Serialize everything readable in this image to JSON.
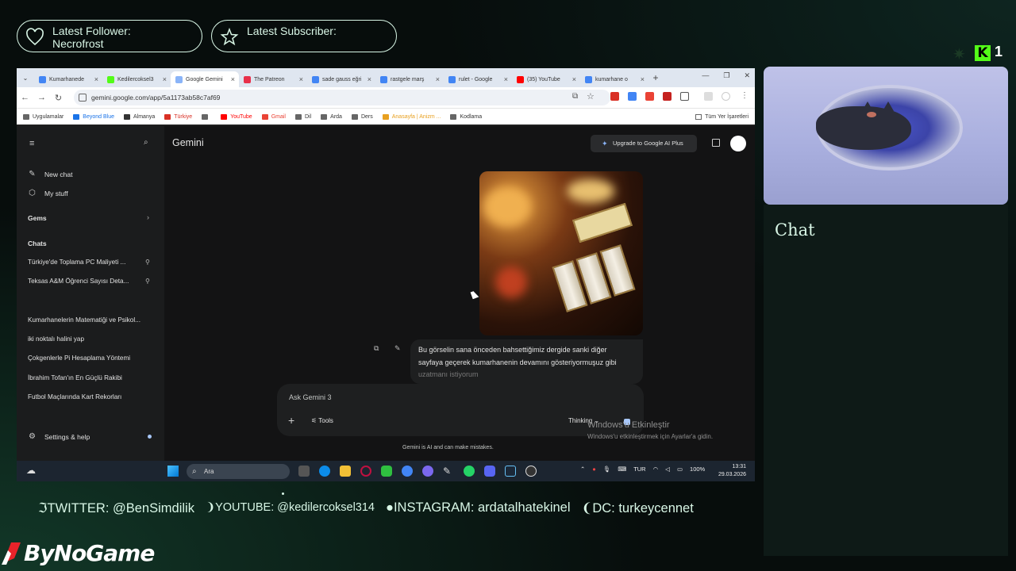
{
  "overlay": {
    "latest_follower_label": "Latest Follower:",
    "latest_follower_name": "Necrofrost",
    "latest_subscriber_label": "Latest Subscriber:",
    "kick_logo": "K",
    "kick_viewers": "1",
    "chat_title": "Chat",
    "socials": {
      "twitter": "TWITTER: @BenSimdilik",
      "youtube": "YOUTUBE: @kedilercoksel314",
      "instagram": "INSTAGRAM: ardatalhatekinel",
      "discord": "DC: turkeycennet"
    },
    "brand": "ByNoGame",
    "accent_color": "#d8f6e6",
    "kick_color": "#53fc18"
  },
  "browser": {
    "tabs": [
      {
        "label": "Kumarhanede",
        "fav_color": "#4285f4"
      },
      {
        "label": "Kedilercoksel3",
        "fav_color": "#53fc18"
      },
      {
        "label": "Google Gemini",
        "fav_color": "#8ab4f8",
        "active": true
      },
      {
        "label": "The Patreon",
        "fav_color": "#e8304a"
      },
      {
        "label": "sade gauss eğri",
        "fav_color": "#4285f4"
      },
      {
        "label": "rastgele marş",
        "fav_color": "#4285f4"
      },
      {
        "label": "rulet - Google",
        "fav_color": "#4285f4"
      },
      {
        "label": "(35) YouTube",
        "fav_color": "#ff0000"
      },
      {
        "label": "kumarhane o",
        "fav_color": "#4285f4"
      }
    ],
    "url": "gemini.google.com/app/5a1173ab58c7af69",
    "bookmarks": [
      {
        "label": "Uygulamalar",
        "color": "#666"
      },
      {
        "label": "Beyond Blue",
        "color": "#1a73e8"
      },
      {
        "label": "Almanya",
        "color": "#333"
      },
      {
        "label": "Türkiye",
        "color": "#d93025"
      },
      {
        "label": "",
        "color": "#666"
      },
      {
        "label": "YouTube",
        "color": "#ff0000"
      },
      {
        "label": "Gmail",
        "color": "#ea4335"
      },
      {
        "label": "Dil",
        "color": "#666"
      },
      {
        "label": "Arda",
        "color": "#666"
      },
      {
        "label": "Ders",
        "color": "#666"
      },
      {
        "label": "Anasayfa | Anizm ...",
        "color": "#e8a020"
      },
      {
        "label": "Kodlama",
        "color": "#666"
      }
    ],
    "bookmarks_all": "Tüm Yer İşaretleri"
  },
  "gemini": {
    "title": "Gemini",
    "upgrade_label": "Upgrade to Google AI Plus",
    "new_chat": "New chat",
    "my_stuff": "My stuff",
    "gems": "Gems",
    "chats": "Chats",
    "chat_items": [
      "Türkiye'de Toplama PC Maliyeti ...",
      "Teksas A&M Öğrenci Sayısı Deta...",
      "Kumarhanelerin Matematiği ve Psikol...",
      "iki noktalı halini yap",
      "Çokgenlerle Pi Hesaplama Yöntemi",
      "İbrahim Tofan'ın En Güçlü Rakibi",
      "Futbol Maçlarında Kart Rekorları"
    ],
    "settings": "Settings & help",
    "user_message_line1": "Bu görselin sana önceden bahsettiğimiz dergide sanki diğer",
    "user_message_line2": "sayfaya geçerek kumarhanenin devamını gösteriyormuşuz gibi",
    "user_message_line3": "uzatmanı istiyorum",
    "input_placeholder": "Ask Gemini 3",
    "tools": "Tools",
    "thinking": "Thinking",
    "disclaimer": "Gemini is AI and can make mistakes.",
    "windows_activate_title": "Windows'u Etkinleştir",
    "windows_activate_sub": "Windows'u etkinleştirmek için Ayarlar'a gidin."
  },
  "taskbar": {
    "search": "Ara",
    "lang": "TUR",
    "battery": "100%",
    "time": "13:31",
    "date": "29.03.2026"
  }
}
